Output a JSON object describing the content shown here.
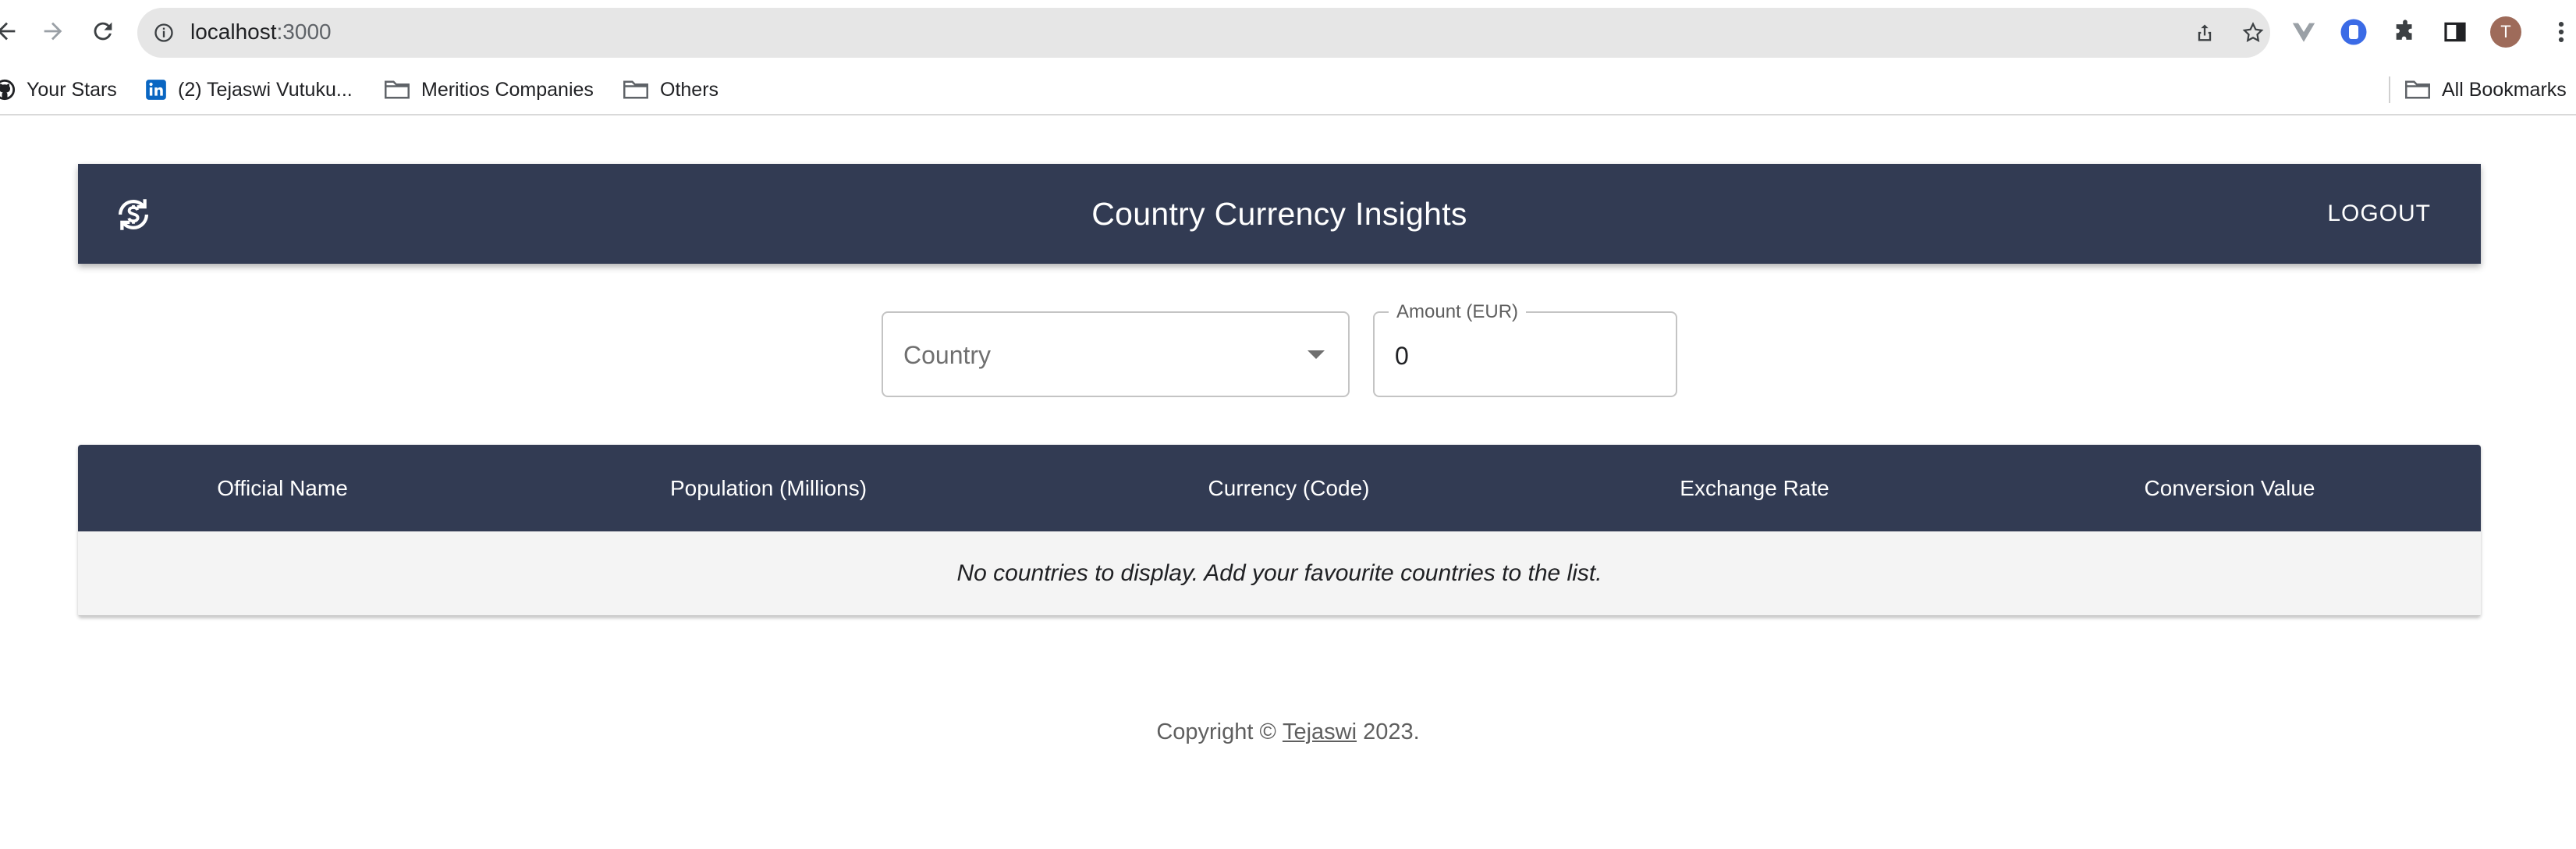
{
  "browser": {
    "url_host": "localhost",
    "url_port": ":3000",
    "avatar_initial": "T",
    "bookmarks": [
      {
        "label": "Your Stars",
        "icon": "github-icon"
      },
      {
        "label": "(2) Tejaswi Vutuku...",
        "icon": "linkedin-icon"
      },
      {
        "label": "Meritios Companies",
        "icon": "folder-icon"
      },
      {
        "label": "Others",
        "icon": "folder-icon"
      }
    ],
    "all_bookmarks_label": "All Bookmarks"
  },
  "header": {
    "title": "Country Currency Insights",
    "logout_label": "LOGOUT",
    "logo_icon": "currency-exchange-icon"
  },
  "filters": {
    "country_placeholder": "Country",
    "amount_label": "Amount (EUR)",
    "amount_value": "0"
  },
  "table": {
    "columns": [
      "Official Name",
      "Population (Millions)",
      "Currency (Code)",
      "Exchange Rate",
      "Conversion Value"
    ],
    "empty_message": "No countries to display. Add your favourite countries to the list."
  },
  "footer": {
    "prefix": "Copyright © ",
    "link_text": "Tejaswi",
    "suffix": " 2023."
  },
  "colors": {
    "header_bg": "#323b53",
    "empty_row_bg": "#f4f4f4"
  }
}
